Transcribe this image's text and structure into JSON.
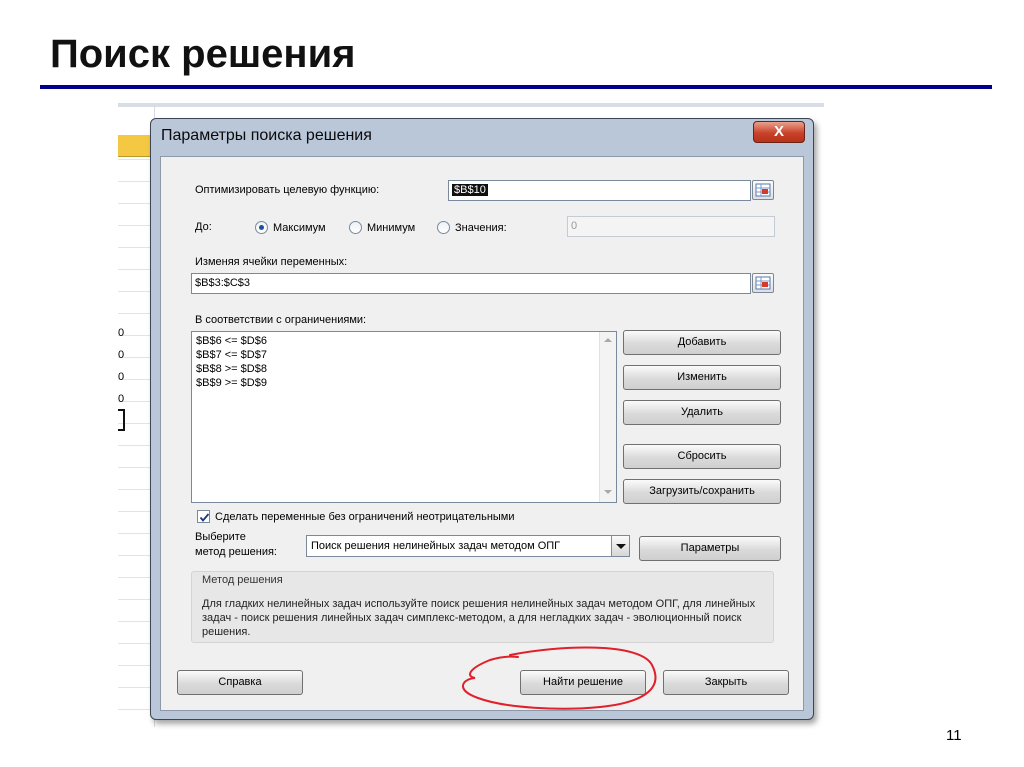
{
  "slide": {
    "title": "Поиск решения",
    "page_number": "11"
  },
  "sheet": {
    "row_digits": [
      "0",
      "0",
      "0",
      "0"
    ]
  },
  "dialog": {
    "title": "Параметры поиска решения",
    "close_label": "X",
    "objective_label": "Оптимизировать целевую функцию:",
    "objective_value": "$B$10",
    "to_label": "До:",
    "radio_max": "Максимум",
    "radio_min": "Минимум",
    "radio_value": "Значения:",
    "value_field": "0",
    "variables_label": "Изменяя ячейки переменных:",
    "variables_value": "$B$3:$C$3",
    "constraints_label": "В соответствии с ограничениями:",
    "constraints": [
      "$B$6 <= $D$6",
      "$B$7 <= $D$7",
      "$B$8 >= $D$8",
      "$B$9 >= $D$9"
    ],
    "buttons": {
      "add": "Добавить",
      "change": "Изменить",
      "delete": "Удалить",
      "reset": "Сбросить",
      "load_save": "Загрузить/сохранить",
      "options": "Параметры",
      "help": "Справка",
      "solve": "Найти решение",
      "close": "Закрыть"
    },
    "nonneg_checkbox": "Сделать переменные без ограничений неотрицательными",
    "method_label_1": "Выберите",
    "method_label_2": "метод решения:",
    "method_value": "Поиск решения нелинейных задач методом ОПГ",
    "method_group_title": "Метод решения",
    "method_description": "Для гладких нелинейных задач используйте поиск решения нелинейных задач методом ОПГ, для линейных задач - поиск решения линейных задач симплекс-методом, а для негладких задач - эволюционный поиск решения."
  },
  "colors": {
    "title_rule": "#00008b",
    "annotation_ellipse": "#e0202a",
    "dialog_frame": "#b9c7d9",
    "close_button": "#c8432a"
  }
}
